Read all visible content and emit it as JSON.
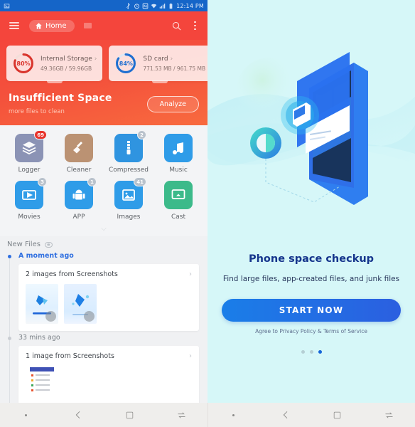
{
  "statusbar": {
    "time": "12:14 PM",
    "icons": [
      "image-icon",
      "bluetooth-icon",
      "alarm-icon",
      "nfc-icon",
      "wifi-icon",
      "signal-icon",
      "battery-icon"
    ]
  },
  "appbar": {
    "home_label": "Home",
    "menu_icon": "hamburger-icon",
    "home_icon": "home-icon",
    "search_icon": "search-icon",
    "more_icon": "more-vertical-icon",
    "bg": "#f4453c"
  },
  "hero": {
    "title": "Insufficient Space",
    "subtitle": "more files to clean",
    "analyze_label": "Analyze",
    "cards": [
      {
        "name": "Internal Storage",
        "percent": "80%",
        "percent_value": 80,
        "detail": "49.36GB / 59.96GB",
        "ring_color": "#d9342c"
      },
      {
        "name": "SD card",
        "percent": "84%",
        "percent_value": 84,
        "detail": "771.53 MB / 961.75 MB",
        "ring_color": "#1f6fd0"
      }
    ]
  },
  "grid": {
    "items": [
      {
        "label": "Logger",
        "icon": "layers-clock-icon",
        "bg": "#8b93b5",
        "badge": "69",
        "badge_color": "#e8342c"
      },
      {
        "label": "Cleaner",
        "icon": "broom-icon",
        "bg": "#bb9273",
        "badge": "",
        "badge_color": ""
      },
      {
        "label": "Compressed",
        "icon": "zip-icon",
        "bg": "#2f94e0",
        "badge": "2",
        "badge_color": "#b9c2cc"
      },
      {
        "label": "Music",
        "icon": "music-note-icon",
        "bg": "#2f9ce8",
        "badge": "",
        "badge_color": ""
      },
      {
        "label": "Movies",
        "icon": "video-play-icon",
        "bg": "#2f9ce8",
        "badge": "3",
        "badge_color": "#b9c2cc"
      },
      {
        "label": "APP",
        "icon": "android-icon",
        "bg": "#2f9ce8",
        "badge": "1",
        "badge_color": "#b9c2cc"
      },
      {
        "label": "Images",
        "icon": "photo-icon",
        "bg": "#2f9ce8",
        "badge": "41",
        "badge_color": "#b9c2cc"
      },
      {
        "label": "Cast",
        "icon": "cast-screen-icon",
        "bg": "#3cba8a",
        "badge": "",
        "badge_color": ""
      }
    ],
    "expand_icon": "chevron-down-icon"
  },
  "newfiles": {
    "heading": "New Files",
    "eye_icon": "eye-icon",
    "groups": [
      {
        "time": "A moment ago",
        "dot_color": "#2f6fe0",
        "time_color": "#2f6fe0",
        "card_title": "2 images from Screenshots",
        "thumb_count": 2
      },
      {
        "time": "33 mins ago",
        "dot_color": "#c9cdd2",
        "time_color": "#7c8288",
        "card_title": "1 image from Screenshots",
        "thumb_count": 1
      }
    ],
    "chevron_icon": "chevron-right-icon"
  },
  "promo": {
    "title": "Phone space checkup",
    "subtitle": "Find large files, app-created files, and junk files",
    "button_label": "START NOW",
    "agreement": "Agree to Privacy Policy & Terms of Service",
    "illustration": "isometric-phone-storage-illustration",
    "page_dots": 3,
    "active_dot": 3,
    "bg": "#d6f7f8"
  },
  "navbar": {
    "items": [
      {
        "icon": "dot-indicator-icon",
        "label": ""
      },
      {
        "icon": "back-arrow-icon",
        "label": ""
      },
      {
        "icon": "home-square-icon",
        "label": ""
      },
      {
        "icon": "recents-switch-icon",
        "label": ""
      }
    ]
  }
}
